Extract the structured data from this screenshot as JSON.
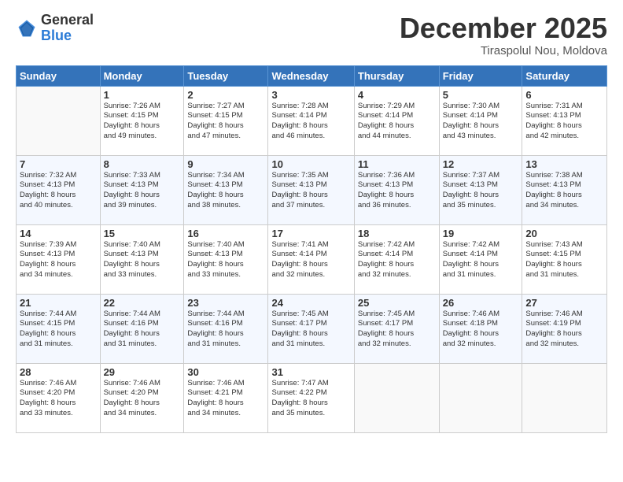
{
  "logo": {
    "general": "General",
    "blue": "Blue"
  },
  "title": "December 2025",
  "location": "Tiraspolul Nou, Moldova",
  "days_of_week": [
    "Sunday",
    "Monday",
    "Tuesday",
    "Wednesday",
    "Thursday",
    "Friday",
    "Saturday"
  ],
  "weeks": [
    [
      {
        "day": "",
        "info": ""
      },
      {
        "day": "1",
        "info": "Sunrise: 7:26 AM\nSunset: 4:15 PM\nDaylight: 8 hours\nand 49 minutes."
      },
      {
        "day": "2",
        "info": "Sunrise: 7:27 AM\nSunset: 4:15 PM\nDaylight: 8 hours\nand 47 minutes."
      },
      {
        "day": "3",
        "info": "Sunrise: 7:28 AM\nSunset: 4:14 PM\nDaylight: 8 hours\nand 46 minutes."
      },
      {
        "day": "4",
        "info": "Sunrise: 7:29 AM\nSunset: 4:14 PM\nDaylight: 8 hours\nand 44 minutes."
      },
      {
        "day": "5",
        "info": "Sunrise: 7:30 AM\nSunset: 4:14 PM\nDaylight: 8 hours\nand 43 minutes."
      },
      {
        "day": "6",
        "info": "Sunrise: 7:31 AM\nSunset: 4:13 PM\nDaylight: 8 hours\nand 42 minutes."
      }
    ],
    [
      {
        "day": "7",
        "info": "Sunrise: 7:32 AM\nSunset: 4:13 PM\nDaylight: 8 hours\nand 40 minutes."
      },
      {
        "day": "8",
        "info": "Sunrise: 7:33 AM\nSunset: 4:13 PM\nDaylight: 8 hours\nand 39 minutes."
      },
      {
        "day": "9",
        "info": "Sunrise: 7:34 AM\nSunset: 4:13 PM\nDaylight: 8 hours\nand 38 minutes."
      },
      {
        "day": "10",
        "info": "Sunrise: 7:35 AM\nSunset: 4:13 PM\nDaylight: 8 hours\nand 37 minutes."
      },
      {
        "day": "11",
        "info": "Sunrise: 7:36 AM\nSunset: 4:13 PM\nDaylight: 8 hours\nand 36 minutes."
      },
      {
        "day": "12",
        "info": "Sunrise: 7:37 AM\nSunset: 4:13 PM\nDaylight: 8 hours\nand 35 minutes."
      },
      {
        "day": "13",
        "info": "Sunrise: 7:38 AM\nSunset: 4:13 PM\nDaylight: 8 hours\nand 34 minutes."
      }
    ],
    [
      {
        "day": "14",
        "info": "Sunrise: 7:39 AM\nSunset: 4:13 PM\nDaylight: 8 hours\nand 34 minutes."
      },
      {
        "day": "15",
        "info": "Sunrise: 7:40 AM\nSunset: 4:13 PM\nDaylight: 8 hours\nand 33 minutes."
      },
      {
        "day": "16",
        "info": "Sunrise: 7:40 AM\nSunset: 4:13 PM\nDaylight: 8 hours\nand 33 minutes."
      },
      {
        "day": "17",
        "info": "Sunrise: 7:41 AM\nSunset: 4:14 PM\nDaylight: 8 hours\nand 32 minutes."
      },
      {
        "day": "18",
        "info": "Sunrise: 7:42 AM\nSunset: 4:14 PM\nDaylight: 8 hours\nand 32 minutes."
      },
      {
        "day": "19",
        "info": "Sunrise: 7:42 AM\nSunset: 4:14 PM\nDaylight: 8 hours\nand 31 minutes."
      },
      {
        "day": "20",
        "info": "Sunrise: 7:43 AM\nSunset: 4:15 PM\nDaylight: 8 hours\nand 31 minutes."
      }
    ],
    [
      {
        "day": "21",
        "info": "Sunrise: 7:44 AM\nSunset: 4:15 PM\nDaylight: 8 hours\nand 31 minutes."
      },
      {
        "day": "22",
        "info": "Sunrise: 7:44 AM\nSunset: 4:16 PM\nDaylight: 8 hours\nand 31 minutes."
      },
      {
        "day": "23",
        "info": "Sunrise: 7:44 AM\nSunset: 4:16 PM\nDaylight: 8 hours\nand 31 minutes."
      },
      {
        "day": "24",
        "info": "Sunrise: 7:45 AM\nSunset: 4:17 PM\nDaylight: 8 hours\nand 31 minutes."
      },
      {
        "day": "25",
        "info": "Sunrise: 7:45 AM\nSunset: 4:17 PM\nDaylight: 8 hours\nand 32 minutes."
      },
      {
        "day": "26",
        "info": "Sunrise: 7:46 AM\nSunset: 4:18 PM\nDaylight: 8 hours\nand 32 minutes."
      },
      {
        "day": "27",
        "info": "Sunrise: 7:46 AM\nSunset: 4:19 PM\nDaylight: 8 hours\nand 32 minutes."
      }
    ],
    [
      {
        "day": "28",
        "info": "Sunrise: 7:46 AM\nSunset: 4:20 PM\nDaylight: 8 hours\nand 33 minutes."
      },
      {
        "day": "29",
        "info": "Sunrise: 7:46 AM\nSunset: 4:20 PM\nDaylight: 8 hours\nand 34 minutes."
      },
      {
        "day": "30",
        "info": "Sunrise: 7:46 AM\nSunset: 4:21 PM\nDaylight: 8 hours\nand 34 minutes."
      },
      {
        "day": "31",
        "info": "Sunrise: 7:47 AM\nSunset: 4:22 PM\nDaylight: 8 hours\nand 35 minutes."
      },
      {
        "day": "",
        "info": ""
      },
      {
        "day": "",
        "info": ""
      },
      {
        "day": "",
        "info": ""
      }
    ]
  ]
}
